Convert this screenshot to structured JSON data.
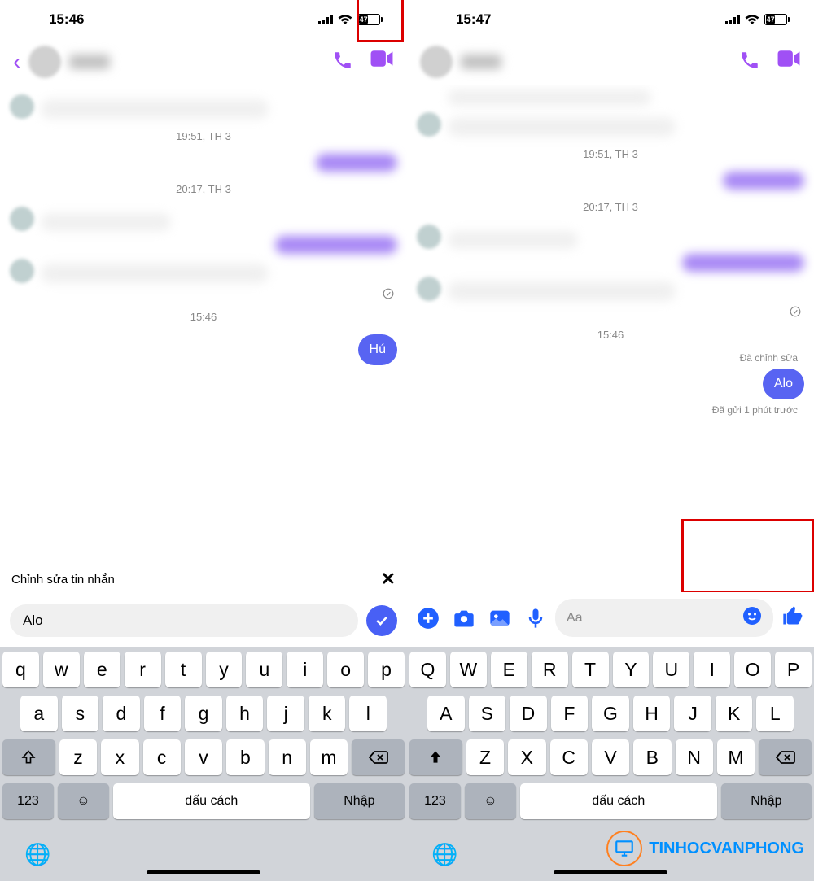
{
  "left": {
    "status_time": "15:46",
    "battery": "47",
    "timestamps": {
      "t1": "19:51, TH 3",
      "t2": "20:17, TH 3",
      "t3": "15:46"
    },
    "bubble_msg": "Hú",
    "edit_bar_title": "Chỉnh sửa tin nhắn",
    "input_value": "Alo"
  },
  "right": {
    "status_time": "15:47",
    "battery": "47",
    "timestamps": {
      "t1": "19:51, TH 3",
      "t2": "20:17, TH 3",
      "t3": "15:46"
    },
    "edited_label": "Đã chỉnh sửa",
    "bubble_msg": "Alo",
    "sent_label": "Đã gửi 1 phút trước",
    "input_placeholder": "Aa"
  },
  "keyboard": {
    "row1_lower": [
      "q",
      "w",
      "e",
      "r",
      "t",
      "y",
      "u",
      "i",
      "o",
      "p"
    ],
    "row1_upper": [
      "Q",
      "W",
      "E",
      "R",
      "T",
      "Y",
      "U",
      "I",
      "O",
      "P"
    ],
    "row2_lower": [
      "a",
      "s",
      "d",
      "f",
      "g",
      "h",
      "j",
      "k",
      "l"
    ],
    "row2_upper": [
      "A",
      "S",
      "D",
      "F",
      "G",
      "H",
      "J",
      "K",
      "L"
    ],
    "row3_lower": [
      "z",
      "x",
      "c",
      "v",
      "b",
      "n",
      "m"
    ],
    "row3_upper": [
      "Z",
      "X",
      "C",
      "V",
      "B",
      "N",
      "M"
    ],
    "num_label": "123",
    "space_label": "dấu cách",
    "enter_label": "Nhập"
  },
  "watermark": "TINHOCVANPHONG"
}
